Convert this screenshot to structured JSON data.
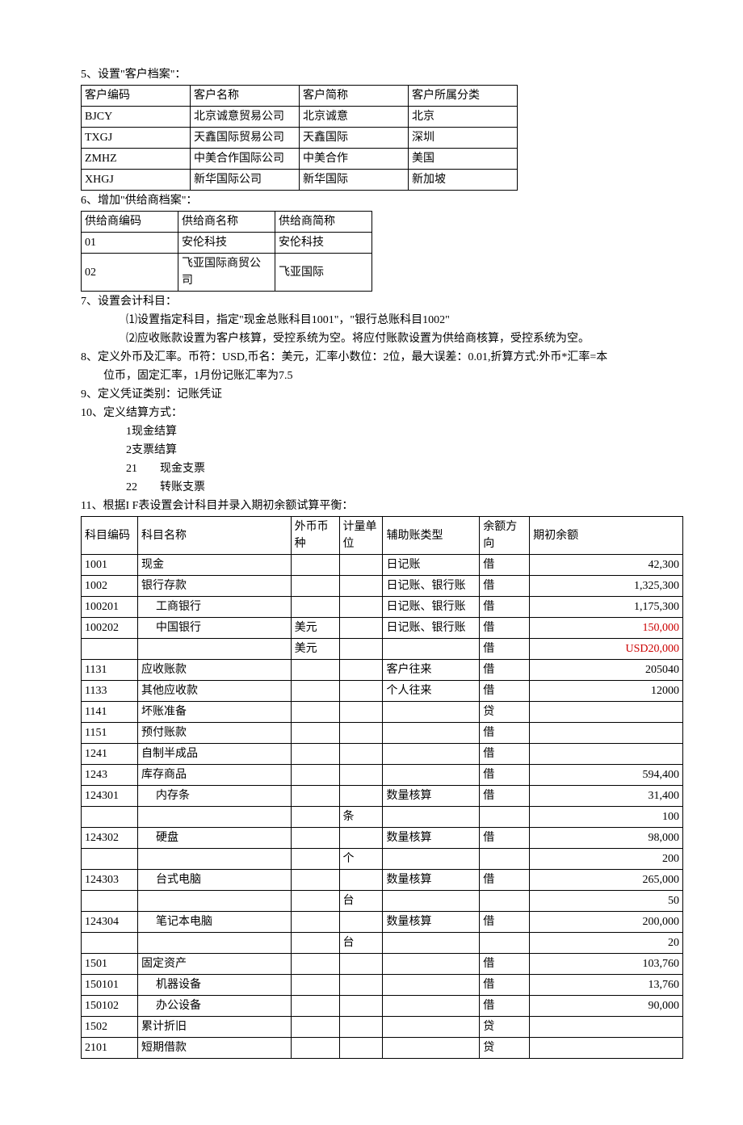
{
  "s5": {
    "title": "5、设置\"客户档案\"：",
    "headers": [
      "客户编码",
      "客户名称",
      "客户简称",
      "客户所属分类"
    ],
    "rows": [
      [
        "BJCY",
        "北京诚意贸易公司",
        "北京诚意",
        "北京"
      ],
      [
        "TXGJ",
        "天鑫国际贸易公司",
        "天鑫国际",
        "深圳"
      ],
      [
        "ZMHZ",
        "中美合作国际公司",
        "中美合作",
        "美国"
      ],
      [
        "XHGJ",
        "新华国际公司",
        "新华国际",
        "新加坡"
      ]
    ]
  },
  "s6": {
    "title": "6、增加\"供给商档案\"：",
    "headers": [
      "供给商编码",
      "供给商名称",
      "供给商简称"
    ],
    "rows": [
      [
        "01",
        "安伦科技",
        "安伦科技"
      ],
      [
        "02",
        "飞亚国际商贸公司",
        "飞亚国际"
      ]
    ]
  },
  "s7": {
    "title": "7、设置会计科目：",
    "line1": "⑴设置指定科目，指定\"现金总账科目1001\"，\"银行总账科目1002\"",
    "line2": "⑵应收账款设置为客户核算，受控系统为空。将应付账款设置为供给商核算，受控系统为空。"
  },
  "s8": {
    "line1": "8、定义外币及汇率。币符：USD,币名：美元，汇率小数位：2位，最大误差：0.01,折算方式:外币*汇率=本",
    "line2": "位币，固定汇率，1月份记账汇率为7.5"
  },
  "s9": {
    "text": "9、定义凭证类别：记账凭证"
  },
  "s10": {
    "title": "10、定义结算方式：",
    "items": [
      {
        "num": "1",
        "text": "现金结算"
      },
      {
        "num": "2",
        "text": "支票结算"
      },
      {
        "num": "21",
        "text": "现金支票"
      },
      {
        "num": "22",
        "text": "转账支票"
      }
    ]
  },
  "s11": {
    "title": "11、根据I F表设置会计科目并录入期初余额试算平衡：",
    "headers": [
      "科目编码",
      "科目名称",
      "外币币种",
      "计量单位",
      "辅助账类型",
      "余额方向",
      "期初余额"
    ],
    "rows": [
      {
        "code": "1001",
        "name": "现金",
        "curr": "",
        "unit": "",
        "aux": "日记账",
        "dir": "借",
        "bal": "42,300",
        "red": false,
        "indent": 0
      },
      {
        "code": "1002",
        "name": "银行存款",
        "curr": "",
        "unit": "",
        "aux": "日记账、银行账",
        "dir": "借",
        "bal": "1,325,300",
        "red": false,
        "indent": 0
      },
      {
        "code": "100201",
        "name": "工商银行",
        "curr": "",
        "unit": "",
        "aux": "日记账、银行账",
        "dir": "借",
        "bal": "1,175,300",
        "red": false,
        "indent": 1
      },
      {
        "code": "100202",
        "name": "中国银行",
        "curr": "美元",
        "unit": "",
        "aux": "日记账、银行账",
        "dir": "借",
        "bal": "150,000",
        "red": true,
        "indent": 1
      },
      {
        "code": "",
        "name": "",
        "curr": "美元",
        "unit": "",
        "aux": "",
        "dir": "借",
        "bal": "USD20,000",
        "red": true,
        "indent": 0
      },
      {
        "code": "1131",
        "name": "应收账款",
        "curr": "",
        "unit": "",
        "aux": "客户往来",
        "dir": "借",
        "bal": "205040",
        "red": false,
        "indent": 0
      },
      {
        "code": "1133",
        "name": "其他应收款",
        "curr": "",
        "unit": "",
        "aux": "个人往来",
        "dir": "借",
        "bal": "12000",
        "red": false,
        "indent": 0
      },
      {
        "code": "1141",
        "name": "坏账准备",
        "curr": "",
        "unit": "",
        "aux": "",
        "dir": "贷",
        "bal": "",
        "red": false,
        "indent": 0
      },
      {
        "code": "1151",
        "name": "预付账款",
        "curr": "",
        "unit": "",
        "aux": "",
        "dir": "借",
        "bal": "",
        "red": false,
        "indent": 0
      },
      {
        "code": "1241",
        "name": "自制半成品",
        "curr": "",
        "unit": "",
        "aux": "",
        "dir": "借",
        "bal": "",
        "red": false,
        "indent": 0
      },
      {
        "code": "1243",
        "name": "库存商品",
        "curr": "",
        "unit": "",
        "aux": "",
        "dir": "借",
        "bal": "594,400",
        "red": false,
        "indent": 0
      },
      {
        "code": "124301",
        "name": "内存条",
        "curr": "",
        "unit": "",
        "aux": "数量核算",
        "dir": "借",
        "bal": "31,400",
        "red": false,
        "indent": 1
      },
      {
        "code": "",
        "name": "",
        "curr": "",
        "unit": "条",
        "aux": "",
        "dir": "",
        "bal": "100",
        "red": false,
        "indent": 0
      },
      {
        "code": "124302",
        "name": "硬盘",
        "curr": "",
        "unit": "",
        "aux": "数量核算",
        "dir": "借",
        "bal": "98,000",
        "red": false,
        "indent": 1
      },
      {
        "code": "",
        "name": "",
        "curr": "",
        "unit": "个",
        "aux": "",
        "dir": "",
        "bal": "200",
        "red": false,
        "indent": 0
      },
      {
        "code": "124303",
        "name": "台式电脑",
        "curr": "",
        "unit": "",
        "aux": "数量核算",
        "dir": "借",
        "bal": "265,000",
        "red": false,
        "indent": 1
      },
      {
        "code": "",
        "name": "",
        "curr": "",
        "unit": "台",
        "aux": "",
        "dir": "",
        "bal": "50",
        "red": false,
        "indent": 0
      },
      {
        "code": "124304",
        "name": "笔记本电脑",
        "curr": "",
        "unit": "",
        "aux": "数量核算",
        "dir": "借",
        "bal": "200,000",
        "red": false,
        "indent": 1
      },
      {
        "code": "",
        "name": "",
        "curr": "",
        "unit": "台",
        "aux": "",
        "dir": "",
        "bal": "20",
        "red": false,
        "indent": 0
      },
      {
        "code": "1501",
        "name": "固定资产",
        "curr": "",
        "unit": "",
        "aux": "",
        "dir": "借",
        "bal": "103,760",
        "red": false,
        "indent": 0
      },
      {
        "code": "150101",
        "name": "机器设备",
        "curr": "",
        "unit": "",
        "aux": "",
        "dir": "借",
        "bal": "13,760",
        "red": false,
        "indent": 1
      },
      {
        "code": "150102",
        "name": "办公设备",
        "curr": "",
        "unit": "",
        "aux": "",
        "dir": "借",
        "bal": "90,000",
        "red": false,
        "indent": 1
      },
      {
        "code": "1502",
        "name": "累计折旧",
        "curr": "",
        "unit": "",
        "aux": "",
        "dir": "贷",
        "bal": "",
        "red": false,
        "indent": 0
      },
      {
        "code": "2101",
        "name": "短期借款",
        "curr": "",
        "unit": "",
        "aux": "",
        "dir": "贷",
        "bal": "",
        "red": false,
        "indent": 0
      }
    ]
  }
}
